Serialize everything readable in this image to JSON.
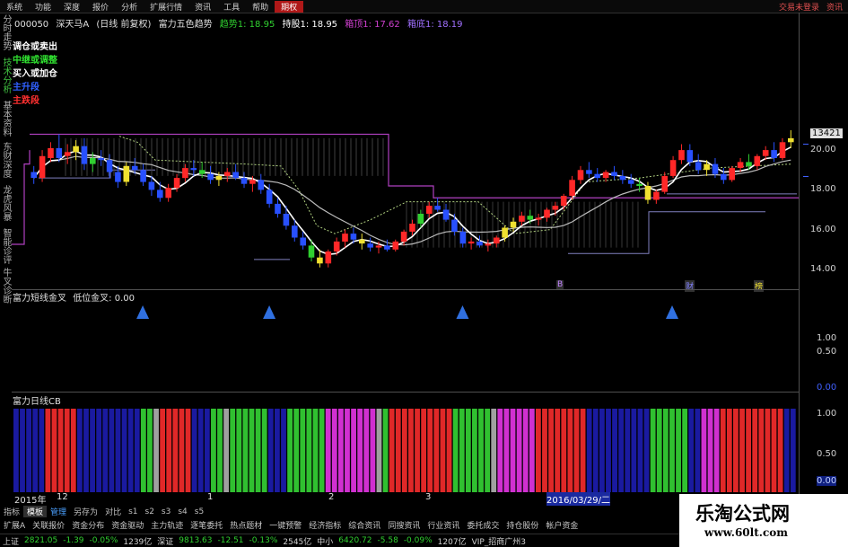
{
  "menu": {
    "items": [
      "系统",
      "功能",
      "深度",
      "报价",
      "分析",
      "扩展行情",
      "资讯",
      "工具",
      "帮助"
    ],
    "active_label": "期权",
    "right": [
      "交易未登录",
      "资讯"
    ]
  },
  "left_tabs": [
    "分时走势",
    "技术分析",
    "基本资料",
    "东财深度",
    "龙虎风暴",
    "智能诊评",
    "牛叉诊断"
  ],
  "title_row": {
    "code": "000050",
    "name": "深天马A",
    "period": "(日线 前复权)",
    "indicator": "富力五色趋势",
    "trend": "趋势1: 18.95",
    "hold": "持股1: 18.95",
    "top": "箱顶1: 17.62",
    "bottom": "箱底1: 18.19"
  },
  "legend": [
    {
      "text": "调仓或卖出",
      "color": "#ffffff"
    },
    {
      "text": "中继或调整",
      "color": "#30e030"
    },
    {
      "text": "买入或加仓",
      "color": "#ffffff"
    },
    {
      "text": "主升段",
      "color": "#3060ff"
    },
    {
      "text": "主跌段",
      "color": "#ff3030"
    }
  ],
  "price_axis": {
    "box": "13421",
    "labels": [
      "20.00",
      "18.00",
      "16.00",
      "14.00"
    ]
  },
  "markers": [
    "B",
    "财",
    "榜"
  ],
  "panel2": {
    "title": "富力短线金叉",
    "sub": "低位金叉: 0.00",
    "labels": [
      "1.00",
      "0.50",
      "0.00"
    ]
  },
  "panel3": {
    "title": "富力日线CB",
    "labels": [
      "1.00",
      "0.50",
      "0.00"
    ]
  },
  "x_axis": [
    "2015年",
    "12",
    "1",
    "2",
    "3",
    "2016/03/29/二"
  ],
  "tabs": [
    "指标",
    "模板",
    "管理",
    "另存为",
    "对比",
    "s1",
    "s2",
    "s3",
    "s4",
    "s5"
  ],
  "menu2": [
    "扩展A",
    "关联报价",
    "资金分布",
    "资金驱动",
    "主力轨迹",
    "逐笔委托",
    "热点题材",
    "一键预警",
    "经济指标",
    "综合资讯",
    "同搜资讯",
    "行业资讯",
    "委托成交",
    "持仓股份",
    "帐户资金"
  ],
  "status": [
    {
      "text": "上证",
      "color": "#d0d0d0"
    },
    {
      "text": "2821.05",
      "color": "#30d030"
    },
    {
      "text": "-1.39",
      "color": "#30d030"
    },
    {
      "text": "-0.05%",
      "color": "#30d030"
    },
    {
      "text": "1239亿",
      "color": "#d0d0d0"
    },
    {
      "text": "深证",
      "color": "#d0d0d0"
    },
    {
      "text": "9813.63",
      "color": "#30d030"
    },
    {
      "text": "-12.51",
      "color": "#30d030"
    },
    {
      "text": "-0.13%",
      "color": "#30d030"
    },
    {
      "text": "2545亿",
      "color": "#d0d0d0"
    },
    {
      "text": "中小",
      "color": "#d0d0d0"
    },
    {
      "text": "6420.72",
      "color": "#30d030"
    },
    {
      "text": "-5.58",
      "color": "#30d030"
    },
    {
      "text": "-0.09%",
      "color": "#30d030"
    },
    {
      "text": "1207亿",
      "color": "#d0d0d0"
    },
    {
      "text": "VIP_招商广州3",
      "color": "#d0d0d0"
    }
  ],
  "watermark": {
    "line1": "乐淘公式网",
    "line2": "www.60lt.com"
  },
  "chart_data": [
    {
      "type": "candlestick",
      "title": "富力五色趋势",
      "ylim": [
        13.5,
        21
      ],
      "y_ticks": [
        14,
        16,
        18,
        20
      ],
      "candles": [
        [
          18.9,
          19.2,
          18.3,
          18.6
        ],
        [
          18.6,
          20.0,
          18.4,
          19.7
        ],
        [
          19.6,
          20.4,
          19.4,
          20.1
        ],
        [
          20.1,
          20.8,
          19.4,
          19.6
        ],
        [
          19.7,
          20.3,
          19.3,
          19.9
        ],
        [
          19.9,
          20.5,
          19.5,
          20.2
        ],
        [
          20.2,
          20.6,
          19.0,
          19.3
        ],
        [
          19.3,
          19.9,
          18.9,
          19.6
        ],
        [
          19.6,
          20.0,
          19.2,
          19.5
        ],
        [
          19.5,
          19.8,
          18.6,
          18.9
        ],
        [
          18.9,
          19.2,
          18.1,
          18.4
        ],
        [
          18.4,
          19.4,
          18.2,
          19.2
        ],
        [
          19.2,
          19.6,
          18.8,
          19.0
        ],
        [
          19.0,
          19.3,
          18.2,
          18.4
        ],
        [
          18.4,
          18.7,
          17.7,
          18.0
        ],
        [
          18.0,
          18.4,
          17.4,
          17.6
        ],
        [
          17.6,
          18.3,
          17.4,
          18.1
        ],
        [
          18.1,
          18.8,
          17.9,
          18.6
        ],
        [
          18.6,
          19.3,
          18.4,
          19.1
        ],
        [
          19.1,
          19.5,
          18.7,
          19.0
        ],
        [
          19.0,
          19.4,
          18.6,
          18.8
        ],
        [
          18.8,
          19.2,
          18.3,
          18.5
        ],
        [
          18.5,
          18.9,
          18.2,
          18.7
        ],
        [
          18.7,
          19.1,
          18.4,
          18.9
        ],
        [
          18.9,
          19.3,
          18.5,
          18.6
        ],
        [
          18.6,
          18.9,
          18.1,
          18.3
        ],
        [
          18.3,
          18.7,
          17.9,
          18.5
        ],
        [
          18.5,
          18.8,
          17.8,
          18.0
        ],
        [
          18.0,
          18.3,
          17.1,
          17.3
        ],
        [
          17.3,
          17.6,
          16.6,
          16.8
        ],
        [
          16.8,
          17.2,
          16.0,
          16.2
        ],
        [
          16.2,
          16.5,
          15.4,
          15.6
        ],
        [
          15.6,
          15.9,
          15.0,
          15.2
        ],
        [
          15.2,
          15.5,
          14.4,
          14.6
        ],
        [
          14.6,
          15.0,
          14.1,
          14.3
        ],
        [
          14.3,
          15.0,
          14.1,
          14.9
        ],
        [
          14.9,
          15.6,
          14.7,
          15.4
        ],
        [
          15.4,
          16.0,
          15.1,
          15.8
        ],
        [
          15.8,
          16.1,
          15.3,
          15.5
        ],
        [
          15.5,
          15.8,
          15.0,
          15.3
        ],
        [
          15.3,
          15.6,
          14.9,
          15.1
        ],
        [
          15.1,
          15.4,
          14.8,
          15.2
        ],
        [
          15.2,
          15.5,
          14.9,
          15.0
        ],
        [
          15.0,
          15.5,
          14.9,
          15.4
        ],
        [
          15.4,
          16.0,
          15.2,
          15.9
        ],
        [
          15.9,
          16.5,
          15.7,
          16.3
        ],
        [
          16.3,
          17.0,
          16.1,
          16.8
        ],
        [
          16.8,
          17.4,
          16.6,
          17.2
        ],
        [
          17.2,
          17.6,
          16.9,
          17.0
        ],
        [
          17.0,
          17.3,
          16.4,
          16.5
        ],
        [
          16.5,
          16.8,
          15.7,
          15.9
        ],
        [
          15.9,
          16.1,
          15.1,
          15.3
        ],
        [
          15.3,
          15.6,
          15.0,
          15.4
        ],
        [
          15.4,
          15.7,
          15.1,
          15.2
        ],
        [
          15.2,
          15.5,
          14.9,
          15.3
        ],
        [
          15.3,
          15.7,
          15.1,
          15.6
        ],
        [
          15.6,
          16.2,
          15.4,
          16.1
        ],
        [
          16.1,
          16.6,
          15.9,
          16.4
        ],
        [
          16.4,
          16.9,
          16.2,
          16.7
        ],
        [
          16.7,
          17.0,
          16.3,
          16.5
        ],
        [
          16.5,
          16.8,
          16.2,
          16.6
        ],
        [
          16.6,
          17.1,
          16.4,
          17.0
        ],
        [
          17.0,
          17.4,
          16.7,
          17.2
        ],
        [
          17.2,
          17.8,
          17.0,
          17.7
        ],
        [
          17.7,
          18.7,
          17.5,
          18.5
        ],
        [
          18.5,
          19.2,
          18.3,
          19.0
        ],
        [
          19.0,
          19.4,
          18.6,
          18.8
        ],
        [
          18.8,
          19.1,
          18.4,
          18.6
        ],
        [
          18.6,
          19.0,
          18.4,
          18.9
        ],
        [
          18.9,
          19.2,
          18.5,
          18.7
        ],
        [
          18.7,
          19.0,
          18.3,
          18.5
        ],
        [
          18.5,
          18.8,
          18.1,
          18.3
        ],
        [
          18.3,
          18.6,
          17.9,
          18.2
        ],
        [
          18.2,
          18.4,
          17.3,
          17.5
        ],
        [
          17.5,
          18.0,
          17.3,
          17.9
        ],
        [
          17.9,
          18.9,
          17.8,
          18.7
        ],
        [
          18.7,
          19.7,
          18.6,
          19.5
        ],
        [
          19.5,
          20.3,
          19.3,
          20.0
        ],
        [
          20.0,
          20.3,
          19.2,
          19.4
        ],
        [
          19.4,
          19.8,
          18.8,
          19.0
        ],
        [
          19.0,
          19.5,
          18.7,
          19.3
        ],
        [
          19.3,
          19.6,
          18.6,
          18.8
        ],
        [
          18.8,
          19.1,
          18.3,
          18.5
        ],
        [
          18.5,
          19.2,
          18.4,
          19.1
        ],
        [
          19.1,
          19.6,
          18.9,
          19.4
        ],
        [
          19.4,
          19.8,
          19.0,
          19.2
        ],
        [
          19.2,
          19.8,
          19.0,
          19.7
        ],
        [
          19.7,
          20.2,
          19.5,
          20.0
        ],
        [
          20.0,
          20.4,
          19.4,
          19.6
        ],
        [
          19.6,
          20.6,
          19.5,
          20.4
        ],
        [
          20.4,
          21.0,
          20.1,
          20.6
        ]
      ]
    },
    {
      "type": "bar",
      "title": "富力短线金叉",
      "ylim": [
        0,
        1
      ],
      "spike_positions": [
        0.155,
        0.318,
        0.567,
        0.837
      ],
      "values": [
        1,
        1,
        1,
        1
      ]
    },
    {
      "type": "bar",
      "title": "富力日线CB",
      "ylim": [
        0,
        1
      ],
      "segments": [
        {
          "color": "#1a1aa0",
          "n": 5
        },
        {
          "color": "#e02828",
          "n": 5
        },
        {
          "color": "#1a1aa0",
          "n": 10
        },
        {
          "color": "#30c030",
          "n": 2
        },
        {
          "color": "#a0a0a0",
          "n": 1
        },
        {
          "color": "#e02828",
          "n": 5
        },
        {
          "color": "#1a1aa0",
          "n": 3
        },
        {
          "color": "#30c030",
          "n": 2
        },
        {
          "color": "#a0a0a0",
          "n": 1
        },
        {
          "color": "#30c030",
          "n": 6
        },
        {
          "color": "#1a1aa0",
          "n": 3
        },
        {
          "color": "#30c030",
          "n": 6
        },
        {
          "color": "#d030d0",
          "n": 8
        },
        {
          "color": "#a0a0a0",
          "n": 1
        },
        {
          "color": "#30c030",
          "n": 1
        },
        {
          "color": "#e02828",
          "n": 10
        },
        {
          "color": "#30c030",
          "n": 6
        },
        {
          "color": "#a0a0a0",
          "n": 1
        },
        {
          "color": "#d030d0",
          "n": 6
        },
        {
          "color": "#e02828",
          "n": 8
        },
        {
          "color": "#1a1aa0",
          "n": 10
        },
        {
          "color": "#30c030",
          "n": 6
        },
        {
          "color": "#1a1aa0",
          "n": 2
        },
        {
          "color": "#d030d0",
          "n": 3
        },
        {
          "color": "#e02828",
          "n": 10
        },
        {
          "color": "#1a1aa0",
          "n": 2
        }
      ]
    }
  ]
}
